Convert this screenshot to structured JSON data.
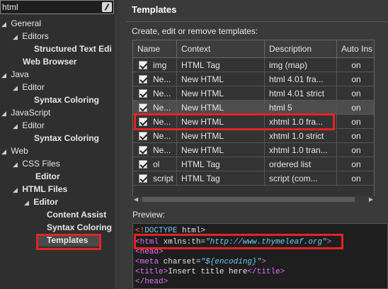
{
  "filter": {
    "value": "html"
  },
  "tree": [
    {
      "label": "General",
      "twisty": "◢"
    },
    {
      "label": "Editors",
      "twisty": "◢"
    },
    {
      "label": "Structured Text Edi",
      "twisty": ""
    },
    {
      "label": "Web Browser",
      "twisty": ""
    },
    {
      "label": "Java",
      "twisty": "◢"
    },
    {
      "label": "Editor",
      "twisty": "◢"
    },
    {
      "label": "Syntax Coloring",
      "twisty": ""
    },
    {
      "label": "JavaScript",
      "twisty": "◢"
    },
    {
      "label": "Editor",
      "twisty": "◢"
    },
    {
      "label": "Syntax Coloring",
      "twisty": ""
    },
    {
      "label": "Web",
      "twisty": "◢"
    },
    {
      "label": "CSS Files",
      "twisty": "◢"
    },
    {
      "label": "Editor",
      "twisty": ""
    },
    {
      "label": "HTML Files",
      "twisty": "◢"
    },
    {
      "label": "Editor",
      "twisty": "◢"
    },
    {
      "label": "Content Assist",
      "twisty": ""
    },
    {
      "label": "Syntax Coloring",
      "twisty": ""
    },
    {
      "label": "Templates",
      "twisty": ""
    }
  ],
  "page": {
    "title": "Templates",
    "description": "Create, edit or remove templates:",
    "preview_label": "Preview:"
  },
  "table": {
    "columns": [
      "Name",
      "Context",
      "Description",
      "Auto Ins"
    ],
    "sort_indicator": "⌄",
    "rows": [
      {
        "name": "img",
        "context": "HTML Tag",
        "description": "img      (map)",
        "auto": "on"
      },
      {
        "name": "Ne...",
        "context": "New HTML",
        "description": "html 4.01 fra...",
        "auto": "on"
      },
      {
        "name": "Ne...",
        "context": "New HTML",
        "description": "html 4.01 strict",
        "auto": "on"
      },
      {
        "name": "Ne...",
        "context": "New HTML",
        "description": "html 5",
        "auto": "on"
      },
      {
        "name": "Ne...",
        "context": "New HTML",
        "description": "xhtml 1.0 fra...",
        "auto": "on"
      },
      {
        "name": "Ne...",
        "context": "New HTML",
        "description": "xhtml 1.0 strict",
        "auto": "on"
      },
      {
        "name": "Ne...",
        "context": "New HTML",
        "description": "xhtml 1.0 tran...",
        "auto": "on"
      },
      {
        "name": "ol",
        "context": "HTML Tag",
        "description": "ordered list",
        "auto": "on"
      },
      {
        "name": "script",
        "context": "HTML Tag",
        "description": "script      (com...",
        "auto": "on"
      }
    ]
  },
  "preview": {
    "l1_open": "<!",
    "l1_doctype": "DOCTYPE",
    "l1_rest": " html>",
    "l2_tag": "html",
    "l2_attr": " xmlns:th=",
    "l2_val": "\"http://www.thymeleaf.org\"",
    "l2_close": ">",
    "l3": "<head>",
    "l4_open": "<",
    "l4_tag": "meta",
    "l4_attr": " charset=",
    "l4_val": "\"${encoding}\"",
    "l4_close": ">",
    "l5_open": "<title>",
    "l5_text": "Insert title here",
    "l5_close": "</title>",
    "l6": "</head>"
  },
  "colors": {
    "annotation": "#e52323",
    "tag": "#e06ff5",
    "value": "#72c7ee"
  }
}
